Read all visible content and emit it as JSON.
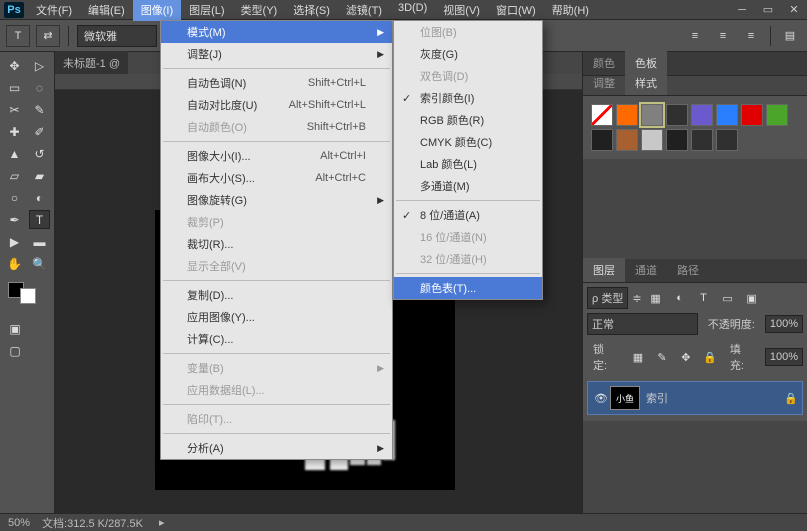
{
  "menubar": {
    "items": [
      "文件(F)",
      "编辑(E)",
      "图像(I)",
      "图层(L)",
      "类型(Y)",
      "选择(S)",
      "滤镜(T)",
      "3D(D)",
      "视图(V)",
      "窗口(W)",
      "帮助(H)"
    ],
    "open_index": 2
  },
  "toolbar": {
    "text_tool_glyph": "T",
    "font": "微软雅"
  },
  "doc": {
    "tab": "未标题-1 @"
  },
  "image_menu": {
    "items": [
      {
        "label": "模式(M)",
        "arrow": true,
        "highlight": true
      },
      {
        "label": "调整(J)",
        "arrow": true
      },
      {
        "sep": true
      },
      {
        "label": "自动色调(N)",
        "shortcut": "Shift+Ctrl+L"
      },
      {
        "label": "自动对比度(U)",
        "shortcut": "Alt+Shift+Ctrl+L"
      },
      {
        "label": "自动颜色(O)",
        "shortcut": "Shift+Ctrl+B",
        "disabled": true
      },
      {
        "sep": true
      },
      {
        "label": "图像大小(I)...",
        "shortcut": "Alt+Ctrl+I"
      },
      {
        "label": "画布大小(S)...",
        "shortcut": "Alt+Ctrl+C"
      },
      {
        "label": "图像旋转(G)",
        "arrow": true
      },
      {
        "label": "裁剪(P)",
        "disabled": true
      },
      {
        "label": "裁切(R)..."
      },
      {
        "label": "显示全部(V)",
        "disabled": true
      },
      {
        "sep": true
      },
      {
        "label": "复制(D)..."
      },
      {
        "label": "应用图像(Y)..."
      },
      {
        "label": "计算(C)..."
      },
      {
        "sep": true
      },
      {
        "label": "变量(B)",
        "arrow": true,
        "disabled": true
      },
      {
        "label": "应用数据组(L)...",
        "disabled": true
      },
      {
        "sep": true
      },
      {
        "label": "陷印(T)...",
        "disabled": true
      },
      {
        "sep": true
      },
      {
        "label": "分析(A)",
        "arrow": true
      }
    ]
  },
  "mode_submenu": {
    "items": [
      {
        "label": "位图(B)",
        "disabled": true
      },
      {
        "label": "灰度(G)"
      },
      {
        "label": "双色调(D)",
        "disabled": true
      },
      {
        "label": "索引颜色(I)",
        "check": true
      },
      {
        "label": "RGB 颜色(R)"
      },
      {
        "label": "CMYK 颜色(C)"
      },
      {
        "label": "Lab 颜色(L)"
      },
      {
        "label": "多通道(M)"
      },
      {
        "sep": true
      },
      {
        "label": "8 位/通道(A)",
        "check": true
      },
      {
        "label": "16 位/通道(N)",
        "disabled": true
      },
      {
        "label": "32 位/通道(H)",
        "disabled": true
      },
      {
        "sep": true
      },
      {
        "label": "颜色表(T)...",
        "highlight": true
      }
    ]
  },
  "swatch_panel": {
    "tabs": [
      "颜色",
      "色板"
    ],
    "subtabs": [
      "调整",
      "样式"
    ],
    "active_tab": 1,
    "active_subtab": 1,
    "colors": [
      "none",
      "#ff6a00",
      "#808080",
      "#303030",
      "#6a5acd",
      "#2a7fff",
      "#e00000",
      "#4aa52a",
      "#202020",
      "#a86030",
      "#c8c8c8",
      "#202020",
      "#303030",
      "#303030"
    ]
  },
  "layers_panel": {
    "tabs": [
      "图层",
      "通道",
      "路径"
    ],
    "active_tab": 0,
    "kind_label": "ρ 类型",
    "blend_mode": "正常",
    "opacity_label": "不透明度:",
    "opacity_value": "100%",
    "lock_label": "锁定:",
    "fill_label": "填充:",
    "fill_value": "100%",
    "layer": {
      "visible": true,
      "thumb_text": "小鱼",
      "label": "索引",
      "locked": true
    }
  },
  "status": {
    "zoom": "50%",
    "doc_size_label": "文档:",
    "doc_size": "312.5 K/287.5K"
  }
}
